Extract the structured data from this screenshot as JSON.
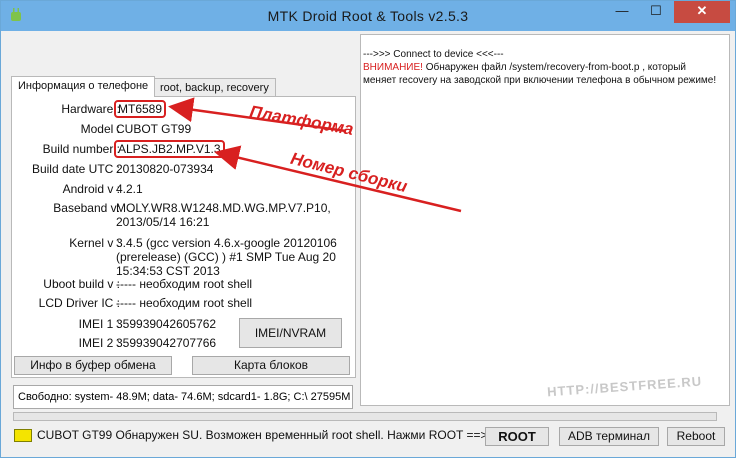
{
  "window": {
    "title": "MTK Droid Root & Tools v2.5.3",
    "controls": {
      "minimize": "—",
      "maximize": "☐",
      "close": "✕"
    }
  },
  "tabs": [
    {
      "label": "Информация о телефоне",
      "active": true
    },
    {
      "label": "root, backup, recovery",
      "active": false
    }
  ],
  "info": {
    "hardware": {
      "label": "Hardware :",
      "value": "MT6589"
    },
    "model": {
      "label": "Model :",
      "value": "CUBOT GT99"
    },
    "build_number": {
      "label": "Build number :",
      "value": "ALPS.JB2.MP.V1.3"
    },
    "build_date": {
      "label": "Build date UTC :",
      "value": "20130820-073934"
    },
    "android": {
      "label": "Android  v :",
      "value": "4.2.1"
    },
    "baseband": {
      "label": "Baseband v:",
      "value_line1": "MOLY.WR8.W1248.MD.WG.MP.V7.P10,",
      "value_line2": "2013/05/14 16:21"
    },
    "kernel": {
      "label": "Kernel v :",
      "value_line1": "3.4.5 (gcc version 4.6.x-google 20120106",
      "value_line2": "(prerelease) (GCC) ) #1 SMP  Tue Aug 20",
      "value_line3": "15:34:53 CST 2013"
    },
    "uboot": {
      "label": "Uboot build v :",
      "value": "----- необходим   root shell"
    },
    "lcd": {
      "label": "LCD Driver IC :",
      "value": "----- необходим   root shell"
    },
    "imei1": {
      "label": "IMEI 1 :",
      "value": "359939042605762"
    },
    "imei2": {
      "label": "IMEI 2 :",
      "value": "359939042707766"
    }
  },
  "buttons": {
    "imei_nvram": "IMEI/NVRAM",
    "info_to_clipboard": "Инфо в буфер обмена",
    "block_map": "Карта блоков",
    "root": "ROOT",
    "adb_terminal": "ADB терминал",
    "reboot": "Reboot"
  },
  "free_space": "Свободно: system- 48.9M; data- 74.6M; sdcard1- 1.8G;  C:\\ 27595M",
  "log": {
    "line1": "--->>> Connect to device <<<---",
    "warning_label": "ВНИМАНИЕ!",
    "warning_text_1": "  Обнаружен файл /system/recovery-from-boot.p , который",
    "warning_text_2": "меняет recovery на заводской при включении телефона в обычном режиме!"
  },
  "status": {
    "text": "CUBOT GT99 Обнаружен SU. Возможен временный root shell. Нажми ROOT ==>",
    "led_color": "#f4e400"
  },
  "annotations": {
    "platform": "Платформа",
    "build_number": "Номер сборки"
  },
  "watermark": "HTTP://BESTFREE.RU",
  "colors": {
    "titlebar": "#6fb0e6",
    "close_button": "#c74b41",
    "highlight_red": "#d82020"
  }
}
